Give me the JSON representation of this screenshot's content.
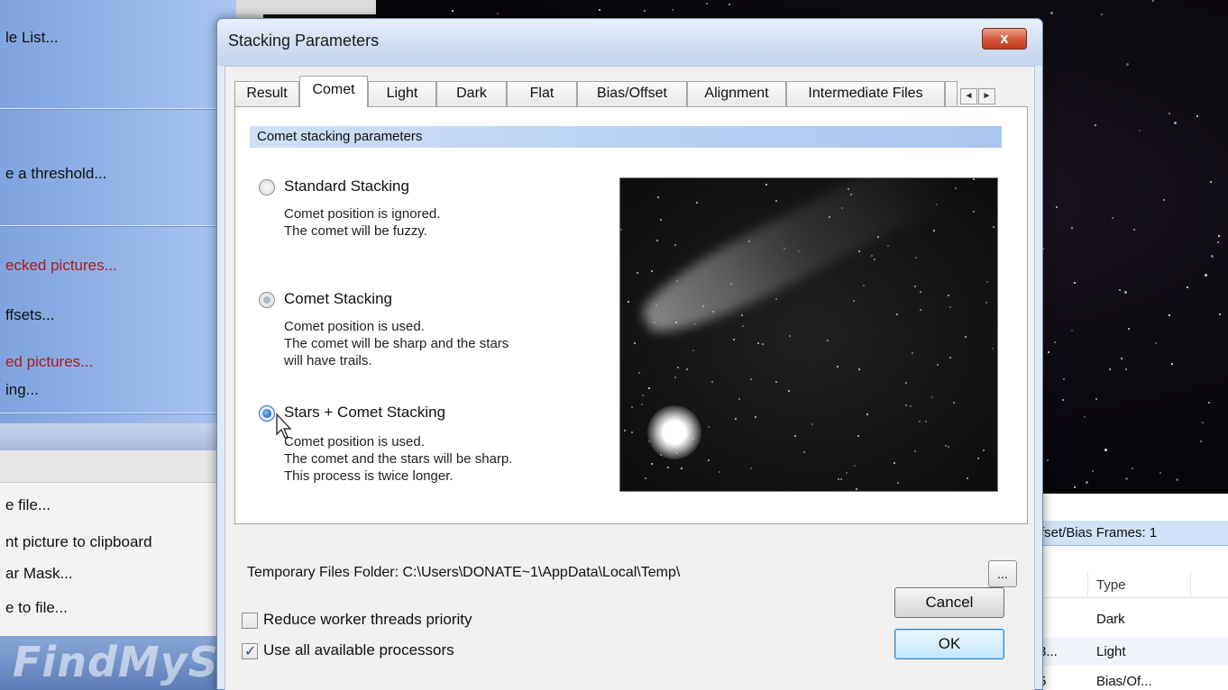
{
  "background_sidebar": {
    "items": [
      {
        "label": "le List...",
        "style": "dark"
      },
      {
        "label": "e a threshold...",
        "style": "dark"
      },
      {
        "label": "ecked pictures...",
        "style": "red"
      },
      {
        "label": "ffsets...",
        "style": "dark"
      },
      {
        "label": "ed pictures...",
        "style": "red"
      },
      {
        "label": "ing...",
        "style": "dark"
      },
      {
        "label": "e file...",
        "style": "dark"
      },
      {
        "label": "nt picture to clipboard",
        "style": "dark"
      },
      {
        "label": "ar Mask...",
        "style": "dark"
      },
      {
        "label": "e to file...",
        "style": "dark"
      }
    ],
    "watermark": "FindMySoft"
  },
  "background_list": {
    "header": "fset/Bias Frames: 1",
    "column_type": "Type",
    "rows": [
      {
        "c1": "",
        "c2": "Dark"
      },
      {
        "c1": "3...",
        "c2": "Light"
      },
      {
        "c1": "5",
        "c2": "Bias/Of..."
      }
    ]
  },
  "dialog": {
    "title": "Stacking Parameters",
    "close_glyph": "x",
    "tabs": [
      {
        "label": "Result",
        "active": false
      },
      {
        "label": "Comet",
        "active": true
      },
      {
        "label": "Light",
        "active": false
      },
      {
        "label": "Dark",
        "active": false
      },
      {
        "label": "Flat",
        "active": false
      },
      {
        "label": "Bias/Offset",
        "active": false
      },
      {
        "label": "Alignment",
        "active": false
      },
      {
        "label": "Intermediate Files",
        "active": false
      }
    ],
    "tab_scroll": {
      "left": "◄",
      "right": "►"
    },
    "group_header": "Comet stacking parameters",
    "options": [
      {
        "label": "Standard Stacking",
        "selected": false,
        "description_1": "Comet position is ignored.",
        "description_2": "The comet will be fuzzy."
      },
      {
        "label": "Comet Stacking",
        "selected": false,
        "description_1": "Comet position is used.",
        "description_2": "The comet will be sharp and the stars",
        "description_3": "will have trails."
      },
      {
        "label": "Stars + Comet Stacking",
        "selected": true,
        "description_1": "Comet position is used.",
        "description_2": "The comet and the stars will be sharp.",
        "description_3": "This process is twice longer."
      }
    ],
    "temp_folder_label": "Temporary Files Folder:",
    "temp_folder_path": "C:\\Users\\DONATE~1\\AppData\\Local\\Temp\\",
    "browse_label": "...",
    "reduce_priority_label": "Reduce worker threads priority",
    "reduce_priority_checked": false,
    "use_all_processors_label": "Use all available processors",
    "use_all_processors_checked": true,
    "cancel_label": "Cancel",
    "ok_label": "OK"
  }
}
